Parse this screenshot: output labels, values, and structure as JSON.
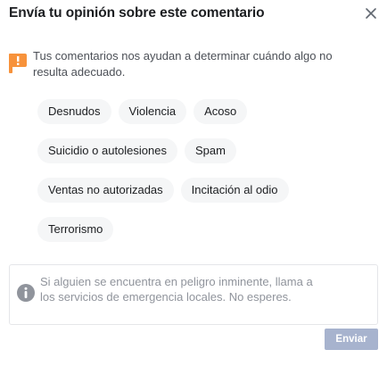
{
  "dialog": {
    "title": "Envía tu opinión sobre este comentario",
    "close_icon": "close-icon"
  },
  "notice": {
    "icon": "flag-icon",
    "icon_color": "#f7923b",
    "text": "Tus comentarios nos ayudan a determinar cuándo algo no resulta adecuado."
  },
  "categories": {
    "row1": [
      "Desnudos",
      "Violencia",
      "Acoso"
    ],
    "row2": [
      "Suicidio o autolesiones",
      "Spam"
    ],
    "row3": [
      "Ventas no autorizadas",
      "Incitación al odio"
    ],
    "row4": [
      "Terrorismo"
    ]
  },
  "info": {
    "icon": "info-icon",
    "text": "Si alguien se encuentra en peligro inminente, llama a los servicios de emergencia locales. No esperes."
  },
  "footer": {
    "send_label": "Enviar",
    "send_color": "#a7b3ce",
    "send_disabled": true
  }
}
